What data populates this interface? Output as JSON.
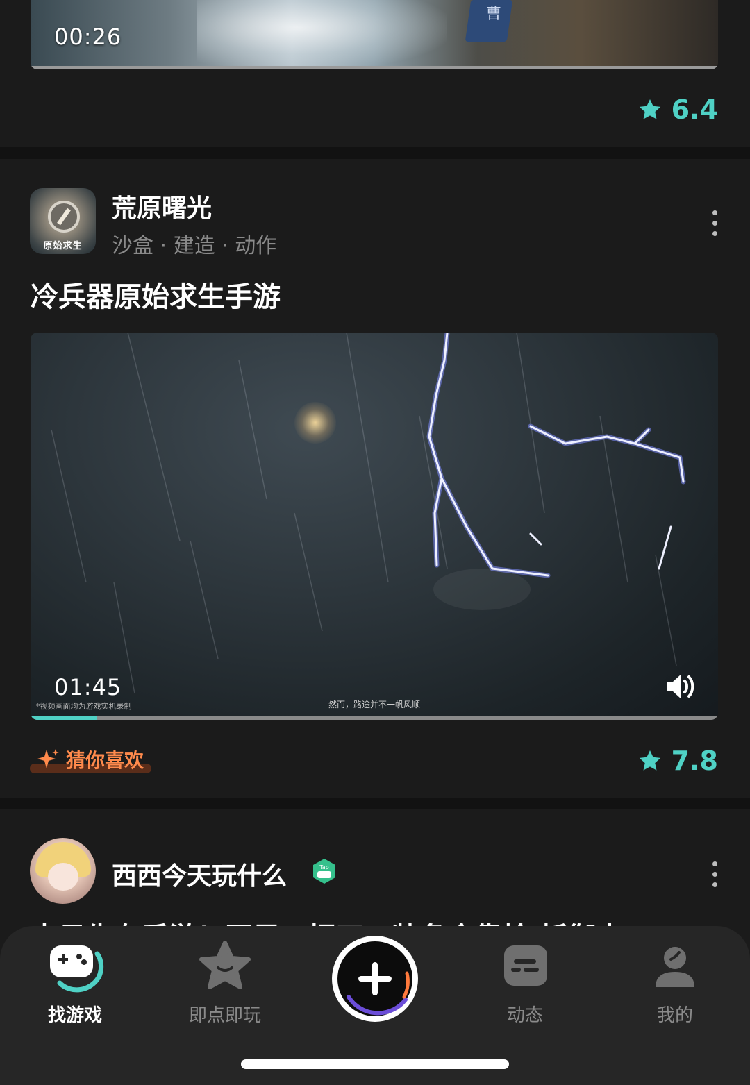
{
  "feed": {
    "card1": {
      "video_time": "00:26",
      "flag_char": "曹",
      "rating": "6.4"
    },
    "card2": {
      "game_name": "荒原曙光",
      "tags": "沙盒 · 建造 · 动作",
      "icon_text": "原始求生",
      "description": "冷兵器原始求生手游",
      "video_time": "01:45",
      "video_note": "*视频画面均为游戏实机录制",
      "video_subtitle": "然而，路途并不一帆风顺",
      "video_progress": 0.096,
      "recommend_label": "猜你喜欢",
      "rating": "7.8"
    },
    "card3": {
      "author_name": "西西今天玩什么",
      "badge_text": "Tap",
      "post_text_partial": "末日生存手游！开局一把刀，装备全靠捡 抵御末"
    }
  },
  "bottom_nav": {
    "items": [
      {
        "label": "找游戏",
        "icon": "gamepad-icon",
        "active": true
      },
      {
        "label": "即点即玩",
        "icon": "star-icon",
        "active": false
      },
      {
        "label": "",
        "icon": "plus-icon",
        "active": false
      },
      {
        "label": "动态",
        "icon": "feed-icon",
        "active": false
      },
      {
        "label": "我的",
        "icon": "person-icon",
        "active": false
      }
    ]
  },
  "colors": {
    "accent": "#4fd1c5",
    "recommend": "#ff8a4c",
    "background": "#121212",
    "card": "#1b1b1b",
    "nav": "#262626"
  }
}
